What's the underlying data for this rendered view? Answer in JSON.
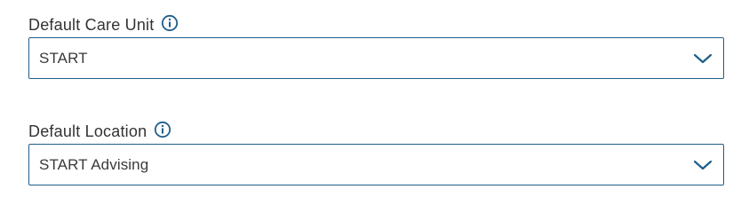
{
  "fields": [
    {
      "label": "Default Care Unit",
      "value": "START",
      "info_icon": "info-icon",
      "dropdown_icon": "chevron-down-icon"
    },
    {
      "label": "Default Location",
      "value": "START Advising",
      "info_icon": "info-icon",
      "dropdown_icon": "chevron-down-icon"
    }
  ],
  "colors": {
    "accent": "#1f5f8b",
    "label_text": "#333333",
    "value_text": "#3a3a3a",
    "background": "#ffffff"
  }
}
